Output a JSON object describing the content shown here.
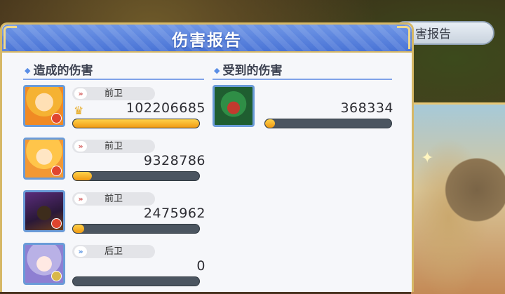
{
  "window": {
    "title": "伤害报告",
    "background_tab_label": "害报告"
  },
  "sections": {
    "dealt": {
      "title": "造成的伤害"
    },
    "taken": {
      "title": "受到的伤害"
    }
  },
  "dealt_rows": [
    {
      "role": "前卫",
      "value": "102206685",
      "crown": true,
      "progress": 1.0,
      "role_color": "red"
    },
    {
      "role": "前卫",
      "value": "9328786",
      "crown": false,
      "progress": 0.15,
      "role_color": "red"
    },
    {
      "role": "前卫",
      "value": "2475962",
      "crown": false,
      "progress": 0.09,
      "role_color": "red"
    },
    {
      "role": "后卫",
      "value": "0",
      "crown": false,
      "progress": 0.0,
      "role_color": "blue"
    }
  ],
  "taken_rows": [
    {
      "value": "368334",
      "progress": 0.08
    }
  ],
  "colors": {
    "title_bar": "#4a74d6",
    "frame_gold": "#d6b866",
    "bar_fill": "#f09a12",
    "bar_track": "#4b5560"
  },
  "icons": {
    "crown": "crown-icon",
    "role_chevron": "chevron-double-right-icon"
  }
}
